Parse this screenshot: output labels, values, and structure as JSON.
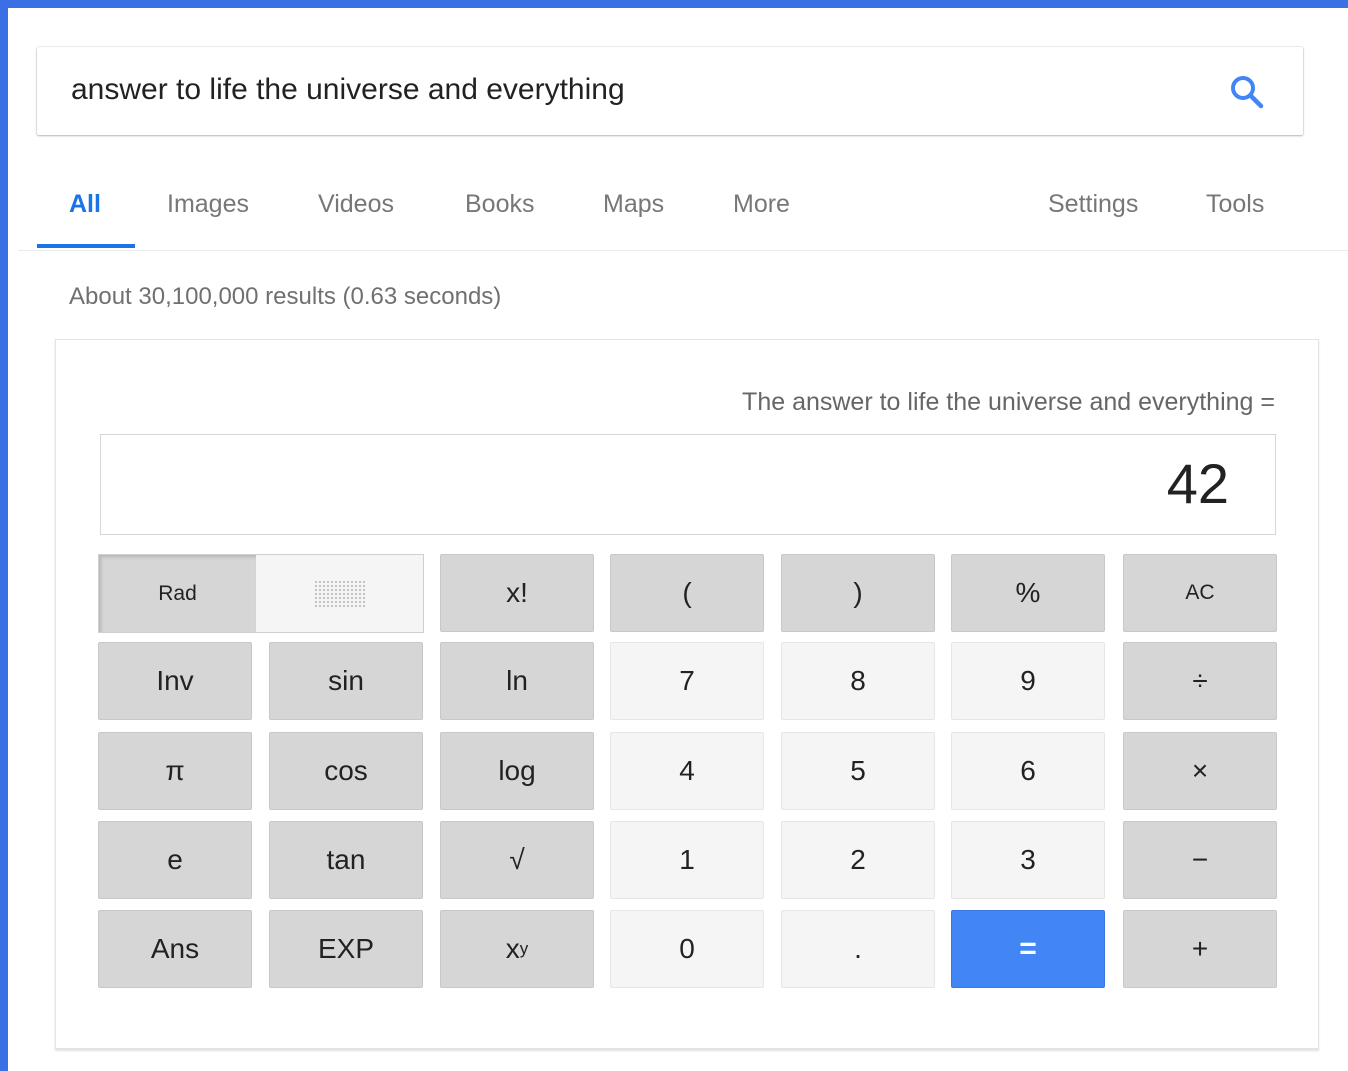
{
  "search": {
    "query": "answer to life the universe and everything"
  },
  "tabs": {
    "all": "All",
    "images": "Images",
    "videos": "Videos",
    "books": "Books",
    "maps": "Maps",
    "more": "More",
    "settings": "Settings",
    "tools": "Tools"
  },
  "results": {
    "stats": "About 30,100,000 results (0.63 seconds)"
  },
  "calculator": {
    "expression": "The answer to life the universe and everything =",
    "result": "42",
    "angle_mode": "Rad",
    "keys": {
      "fact": "x!",
      "lparen": "(",
      "rparen": ")",
      "percent": "%",
      "ac": "AC",
      "inv": "Inv",
      "sin": "sin",
      "ln": "ln",
      "seven": "7",
      "eight": "8",
      "nine": "9",
      "divide": "÷",
      "pi": "π",
      "cos": "cos",
      "log": "log",
      "four": "4",
      "five": "5",
      "six": "6",
      "multiply": "×",
      "e": "e",
      "tan": "tan",
      "sqrt": "√",
      "one": "1",
      "two": "2",
      "three": "3",
      "minus": "−",
      "ans": "Ans",
      "exp": "EXP",
      "pow_base": "x",
      "pow_exp": "y",
      "zero": "0",
      "dot": ".",
      "equals": "=",
      "plus": "+"
    }
  },
  "colors": {
    "frame": "#3b6fe5",
    "accent_blue": "#1a73e8",
    "equals_key": "#4285f4",
    "fn_key": "#d6d6d6",
    "num_key": "#f5f5f5"
  },
  "icons": {
    "search": "search-icon"
  }
}
